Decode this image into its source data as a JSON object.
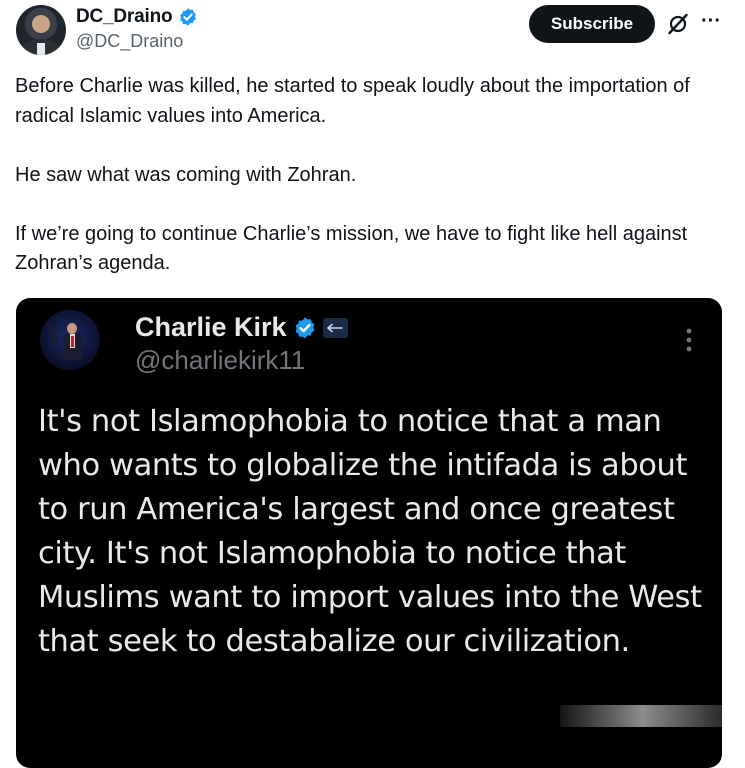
{
  "post": {
    "display_name": "DC_Draino",
    "handle": "@DC_Draino",
    "subscribe_label": "Subscribe",
    "more_glyph": "···",
    "paragraphs": [
      "Before Charlie was killed, he started to speak loudly about the importation of radical Islamic values into America.",
      "He saw what was coming with Zohran.",
      "If we’re going to continue Charlie’s mission, we have to fight like hell against Zohran’s agenda."
    ]
  },
  "quote": {
    "display_name": "Charlie Kirk",
    "handle": "@charliekirk11",
    "text": "It's not Islamophobia to notice that a man who wants to globalize the intifada is about to run America's largest and once greatest city. It's not Islamophobia to notice that Muslims want to import values into the West that seek to destabalize our civilization."
  },
  "colors": {
    "verified_blue": "#1d9bf0",
    "quote_background": "#000000",
    "subscribe_background": "#0f1419",
    "secondary_text": "#536471"
  },
  "icons": [
    "verified-badge-icon",
    "grok-icon",
    "more-icon",
    "affiliate-badge-icon",
    "vertical-more-icon"
  ]
}
